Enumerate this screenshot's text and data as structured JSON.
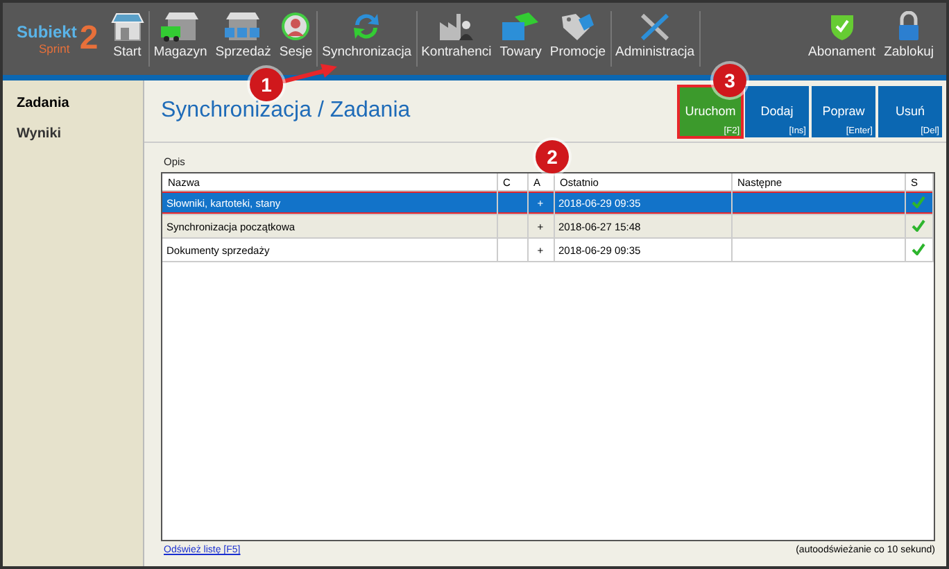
{
  "app": {
    "logo_name": "Subiekt",
    "logo_sub": "Sprint",
    "logo_num": "2"
  },
  "toolbar": {
    "groups": [
      [
        {
          "label": "Start"
        }
      ],
      [
        {
          "label": "Magazyn"
        },
        {
          "label": "Sprzedaż"
        },
        {
          "label": "Sesje"
        }
      ],
      [
        {
          "label": "Synchronizacja"
        }
      ],
      [
        {
          "label": "Kontrahenci"
        },
        {
          "label": "Towary"
        },
        {
          "label": "Promocje"
        }
      ],
      [
        {
          "label": "Administracja"
        }
      ]
    ],
    "right": [
      {
        "label": "Abonament"
      },
      {
        "label": "Zablokuj"
      }
    ]
  },
  "sidebar": {
    "items": [
      {
        "label": "Zadania",
        "selected": true
      },
      {
        "label": "Wyniki",
        "selected": false
      }
    ]
  },
  "title": "Synchronizacja / Zadania",
  "actions": [
    {
      "label": "Uruchom",
      "shortcut": "[F2]",
      "kind": "run",
      "highlighted": true
    },
    {
      "label": "Dodaj",
      "shortcut": "[Ins]",
      "kind": "normal",
      "highlighted": false
    },
    {
      "label": "Popraw",
      "shortcut": "[Enter]",
      "kind": "normal",
      "highlighted": false
    },
    {
      "label": "Usuń",
      "shortcut": "[Del]",
      "kind": "normal",
      "highlighted": false
    }
  ],
  "section_label": "Opis",
  "table": {
    "columns": [
      "Nazwa",
      "C",
      "A",
      "Ostatnio",
      "Następne",
      "S"
    ],
    "rows": [
      {
        "cells": [
          "Słowniki, kartoteki, stany",
          "",
          "+",
          "2018-06-29 09:35",
          ""
        ],
        "synced": true,
        "selected": true,
        "highlighted": true
      },
      {
        "cells": [
          "Synchronizacja początkowa",
          "",
          "+",
          "2018-06-27 15:48",
          ""
        ],
        "synced": true,
        "selected": false,
        "highlighted": false
      },
      {
        "cells": [
          "Dokumenty sprzedaży",
          "",
          "+",
          "2018-06-29 09:35",
          ""
        ],
        "synced": true,
        "selected": false,
        "highlighted": false
      }
    ]
  },
  "refresh_link": "Odśwież listę [F5]",
  "auto_refresh_note": "(autoodświeżanie co 10 sekund)",
  "callouts": [
    "1",
    "2",
    "3"
  ]
}
